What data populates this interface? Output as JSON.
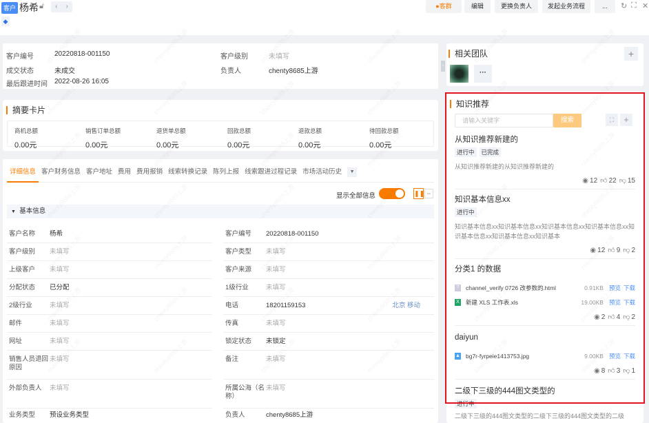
{
  "header": {
    "badge": "客户",
    "title": "杨希",
    "prev": "‹",
    "next": "›",
    "buttons": {
      "group": "客群",
      "edit": "编辑",
      "change_owner": "更换负责人",
      "start_flow": "发起业务流程",
      "more": "..."
    }
  },
  "overview": {
    "fields": [
      {
        "label": "客户编号",
        "value": "20220818-001150"
      },
      {
        "label": "客户级别",
        "value": "未填写"
      },
      {
        "label": "成交状态",
        "value": "未成交"
      },
      {
        "label": "负责人",
        "value": "chenty8685上游"
      },
      {
        "label": "最后跟进时间",
        "value": "2022-08-26 16:05"
      }
    ]
  },
  "summary": {
    "title": "摘要卡片",
    "items": [
      {
        "label": "商机总额",
        "value": "0.00元"
      },
      {
        "label": "销售订单总额",
        "value": "0.00元"
      },
      {
        "label": "退货单总额",
        "value": "0.00元"
      },
      {
        "label": "回款总额",
        "value": "0.00元"
      },
      {
        "label": "退款总额",
        "value": "0.00元"
      },
      {
        "label": "待回款总额",
        "value": "0.00元"
      }
    ]
  },
  "tabs": [
    "详细信息",
    "客户财务信息",
    "客户地址",
    "费用",
    "费用报销",
    "线索转换记录",
    "陈列上报",
    "线索跟进过程记录",
    "市场活动历史"
  ],
  "show_all_label": "显示全部信息",
  "section_title": "基本信息",
  "detail_rows": [
    [
      {
        "label": "客户名称",
        "value": "杨希"
      },
      {
        "label": "客户编号",
        "value": "20220818-001150"
      }
    ],
    [
      {
        "label": "客户级别",
        "value": "未填写",
        "empty": true
      },
      {
        "label": "客户类型",
        "value": "未填写",
        "empty": true
      }
    ],
    [
      {
        "label": "上级客户",
        "value": "未填写",
        "empty": true
      },
      {
        "label": "客户来源",
        "value": "未填写",
        "empty": true
      }
    ],
    [
      {
        "label": "分配状态",
        "value": "已分配"
      },
      {
        "label": "1级行业",
        "value": "未填写",
        "empty": true
      }
    ],
    [
      {
        "label": "2级行业",
        "value": "未填写",
        "empty": true
      },
      {
        "label": "电话",
        "value": "18201159153",
        "extra": "北京 移动"
      }
    ],
    [
      {
        "label": "邮件",
        "value": "未填写",
        "empty": true
      },
      {
        "label": "传真",
        "value": "未填写",
        "empty": true
      }
    ],
    [
      {
        "label": "网址",
        "value": "未填写",
        "empty": true
      },
      {
        "label": "锁定状态",
        "value": "未锁定"
      }
    ],
    [
      {
        "label": "销售人员退回原因",
        "value": "未填写",
        "empty": true
      },
      {
        "label": "备注",
        "value": "未填写",
        "empty": true
      }
    ],
    [
      {
        "label": "外部负责人",
        "value": "未填写",
        "empty": true
      },
      {
        "label": "所属公海（名称）",
        "value": "未填写",
        "empty": true
      }
    ],
    [
      {
        "label": "业务类型",
        "value": "预设业务类型"
      },
      {
        "label": "负责人",
        "value": "chenty8685上游"
      }
    ]
  ],
  "team": {
    "title": "相关团队",
    "more": "···",
    "add": "+"
  },
  "knowledge": {
    "title": "知识推荐",
    "search_placeholder": "请输入关键字",
    "search_button": "搜索",
    "add": "+",
    "items": [
      {
        "title": "从知识推荐新建的",
        "statuses": [
          "进行中",
          "已完成"
        ],
        "desc": "从知识推荐新建的从知识推荐新建的",
        "views": "12",
        "likes": "22",
        "dislikes": "15"
      },
      {
        "title": "知识基本信息xx",
        "statuses": [
          "进行中"
        ],
        "desc": "知识基本信息xx知识基本信息xx知识基本信息xx知识基本信息xx知识基本信息xx知识基本信息xx知识基本",
        "views": "12",
        "likes": "9",
        "dislikes": "2"
      },
      {
        "title": "分类1 的数据",
        "files": [
          {
            "name": "channel_verify 0726 改参数的.html",
            "size": "0.91KB",
            "type": "unknown"
          },
          {
            "name": "新建 XLS 工作表.xls",
            "size": "19.00KB",
            "type": "excel"
          }
        ],
        "views": "2",
        "likes": "4",
        "dislikes": "2"
      },
      {
        "title": "daiyun",
        "files": [
          {
            "name": "bg7r-fyrpeie1413753.jpg",
            "size": "9.00KB",
            "type": "image"
          }
        ],
        "views": "8",
        "likes": "3",
        "dislikes": "1"
      },
      {
        "title": "二级下三级的444图文类型的",
        "statuses": [
          "进行中"
        ],
        "desc": "二级下三级的444图文类型的二级下三级的444图文类型的二级"
      }
    ],
    "preview": "预览",
    "download": "下载"
  },
  "colors": {
    "accent": "#f97b00",
    "link": "#4a8ef5",
    "highlight": "#e0141e"
  }
}
